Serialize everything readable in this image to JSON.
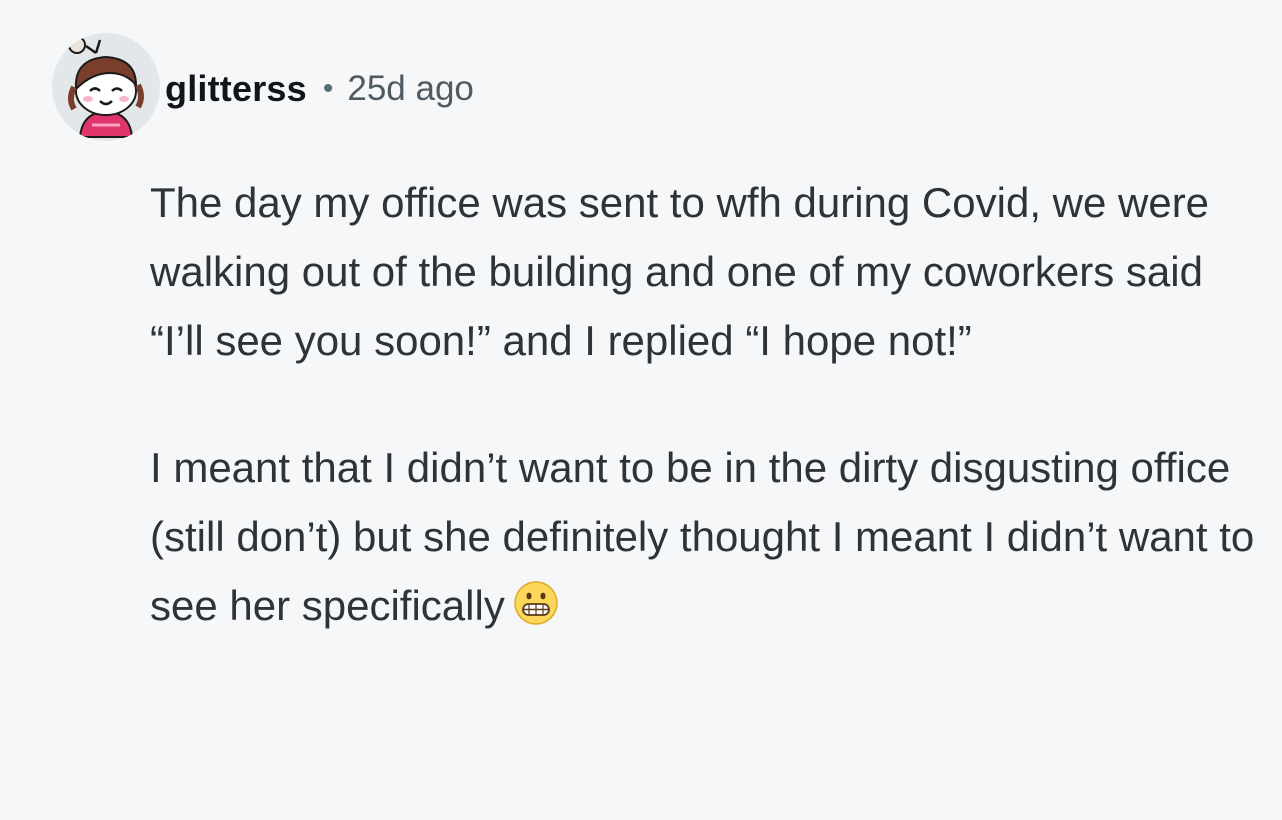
{
  "comment": {
    "author": {
      "username": "glitterss",
      "avatar_icon": "snoo-avatar-icon"
    },
    "separator": "•",
    "timestamp": "25d ago",
    "paragraphs": [
      "The day my office was sent to wfh during Covid, we were walking out of the building and one of my coworkers said “I’ll see you soon!” and I replied “I hope not!”",
      "I meant that I didn’t want to be in the dirty disgusting office (still don’t) but she definitely thought I meant I didn’t want to see her specifically"
    ],
    "trailing_emoji": "grimacing-face-icon"
  },
  "colors": {
    "background": "#f6f7f8",
    "text": "#2e3338",
    "username": "#111418",
    "meta": "#4f5b63"
  }
}
